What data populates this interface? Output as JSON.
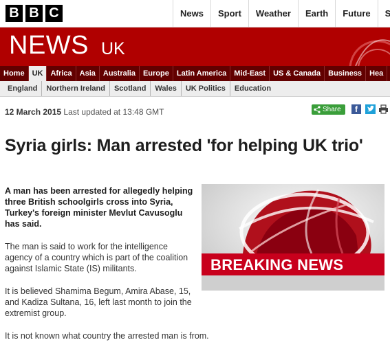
{
  "brand": {
    "letters": [
      "B",
      "B",
      "C"
    ],
    "section": "NEWS",
    "edition": "UK"
  },
  "top_nav": [
    "News",
    "Sport",
    "Weather",
    "Earth",
    "Future",
    "Sho"
  ],
  "main_nav": [
    "Home",
    "UK",
    "Africa",
    "Asia",
    "Australia",
    "Europe",
    "Latin America",
    "Mid-East",
    "US & Canada",
    "Business",
    "Hea"
  ],
  "main_nav_active": "UK",
  "sub_nav": [
    "England",
    "Northern Ireland",
    "Scotland",
    "Wales",
    "UK Politics",
    "Education"
  ],
  "article": {
    "date": "12 March 2015",
    "updated": "Last updated at 13:48 GMT",
    "share_label": "Share",
    "headline": "Syria girls: Man arrested 'for helping UK trio'",
    "intro": "A man has been arrested for allegedly helping three British schoolgirls cross into Syria, Turkey's foreign minister Mevlut Cavusoglu has said.",
    "paragraphs": [
      "The man is said to work for the intelligence agency of a country which is part of the coalition against Islamic State (IS) militants.",
      "It is believed Shamima Begum, Amira Abase, 15, and Kadiza Sultana, 16, left last month to join the extremist group.",
      "It is not known what country the arrested man is from."
    ],
    "image_caption_text": "BREAKING NEWS"
  },
  "icons": {
    "share": "share-icon",
    "facebook": "facebook-icon",
    "twitter": "twitter-icon",
    "print": "print-icon"
  },
  "colors": {
    "masthead": "#b00000",
    "nav": "#620000",
    "breaking": "#c8001c",
    "share": "#3a9e3a"
  }
}
